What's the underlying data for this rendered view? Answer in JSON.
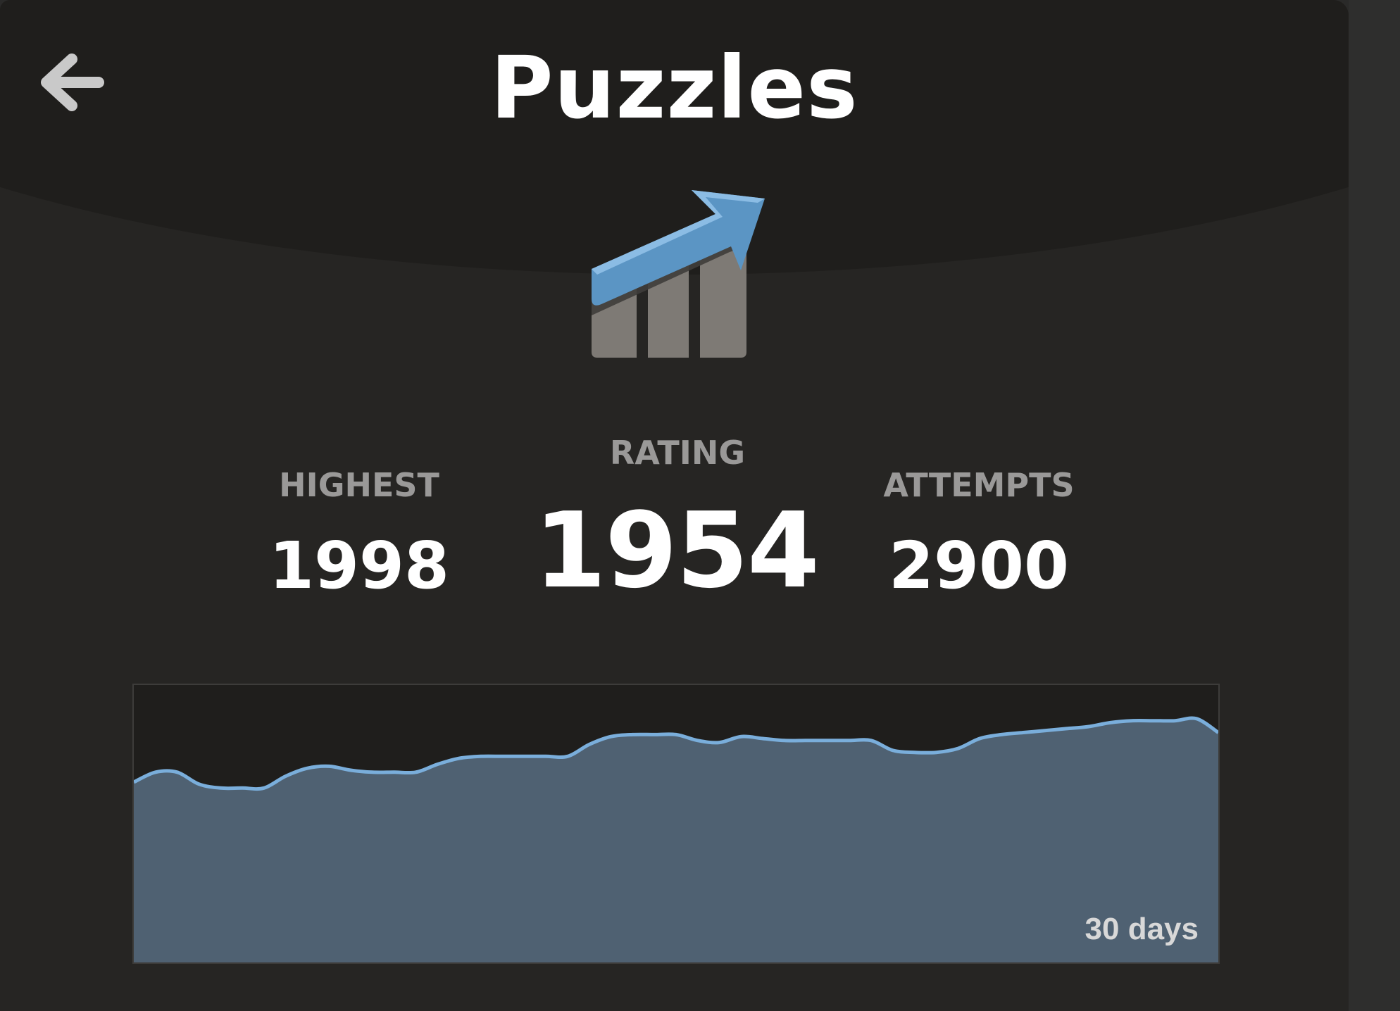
{
  "header": {
    "title": "Puzzles"
  },
  "icons": {
    "back": "arrow-left-icon",
    "stat": "rising-chart-icon"
  },
  "stats": {
    "highest": {
      "label": "HIGHEST",
      "value": "1998"
    },
    "rating": {
      "label": "RATING",
      "value": "1954"
    },
    "attempts": {
      "label": "ATTEMPTS",
      "value": "2900"
    }
  },
  "colors": {
    "accent": "#5b95c4",
    "line": "#7aaedb",
    "area": "#4f6172",
    "background": "#262523"
  },
  "chart_data": {
    "type": "area",
    "range_label": "30 days",
    "x": [
      0,
      1,
      2,
      3,
      4,
      5,
      6,
      7,
      8,
      9,
      10,
      11,
      12,
      13,
      14,
      15,
      16,
      17,
      18,
      19,
      20,
      21,
      22,
      23,
      24,
      25,
      26,
      27,
      28,
      29,
      30,
      31,
      32,
      33,
      34,
      35,
      36,
      37,
      38,
      39,
      40,
      41,
      42,
      43,
      44,
      45,
      46,
      47,
      48,
      49,
      50
    ],
    "values": [
      1841,
      1846,
      1846,
      1840,
      1838,
      1838,
      1838,
      1844,
      1848,
      1849,
      1847,
      1846,
      1846,
      1846,
      1850,
      1853,
      1854,
      1854,
      1854,
      1854,
      1854,
      1860,
      1864,
      1865,
      1865,
      1865,
      1862,
      1861,
      1864,
      1863,
      1862,
      1862,
      1862,
      1862,
      1862,
      1857,
      1856,
      1856,
      1858,
      1863,
      1865,
      1866,
      1867,
      1868,
      1869,
      1871,
      1872,
      1872,
      1872,
      1873,
      1866
    ],
    "ylim": [
      1750,
      1890
    ],
    "grid": false,
    "legend": "none"
  }
}
